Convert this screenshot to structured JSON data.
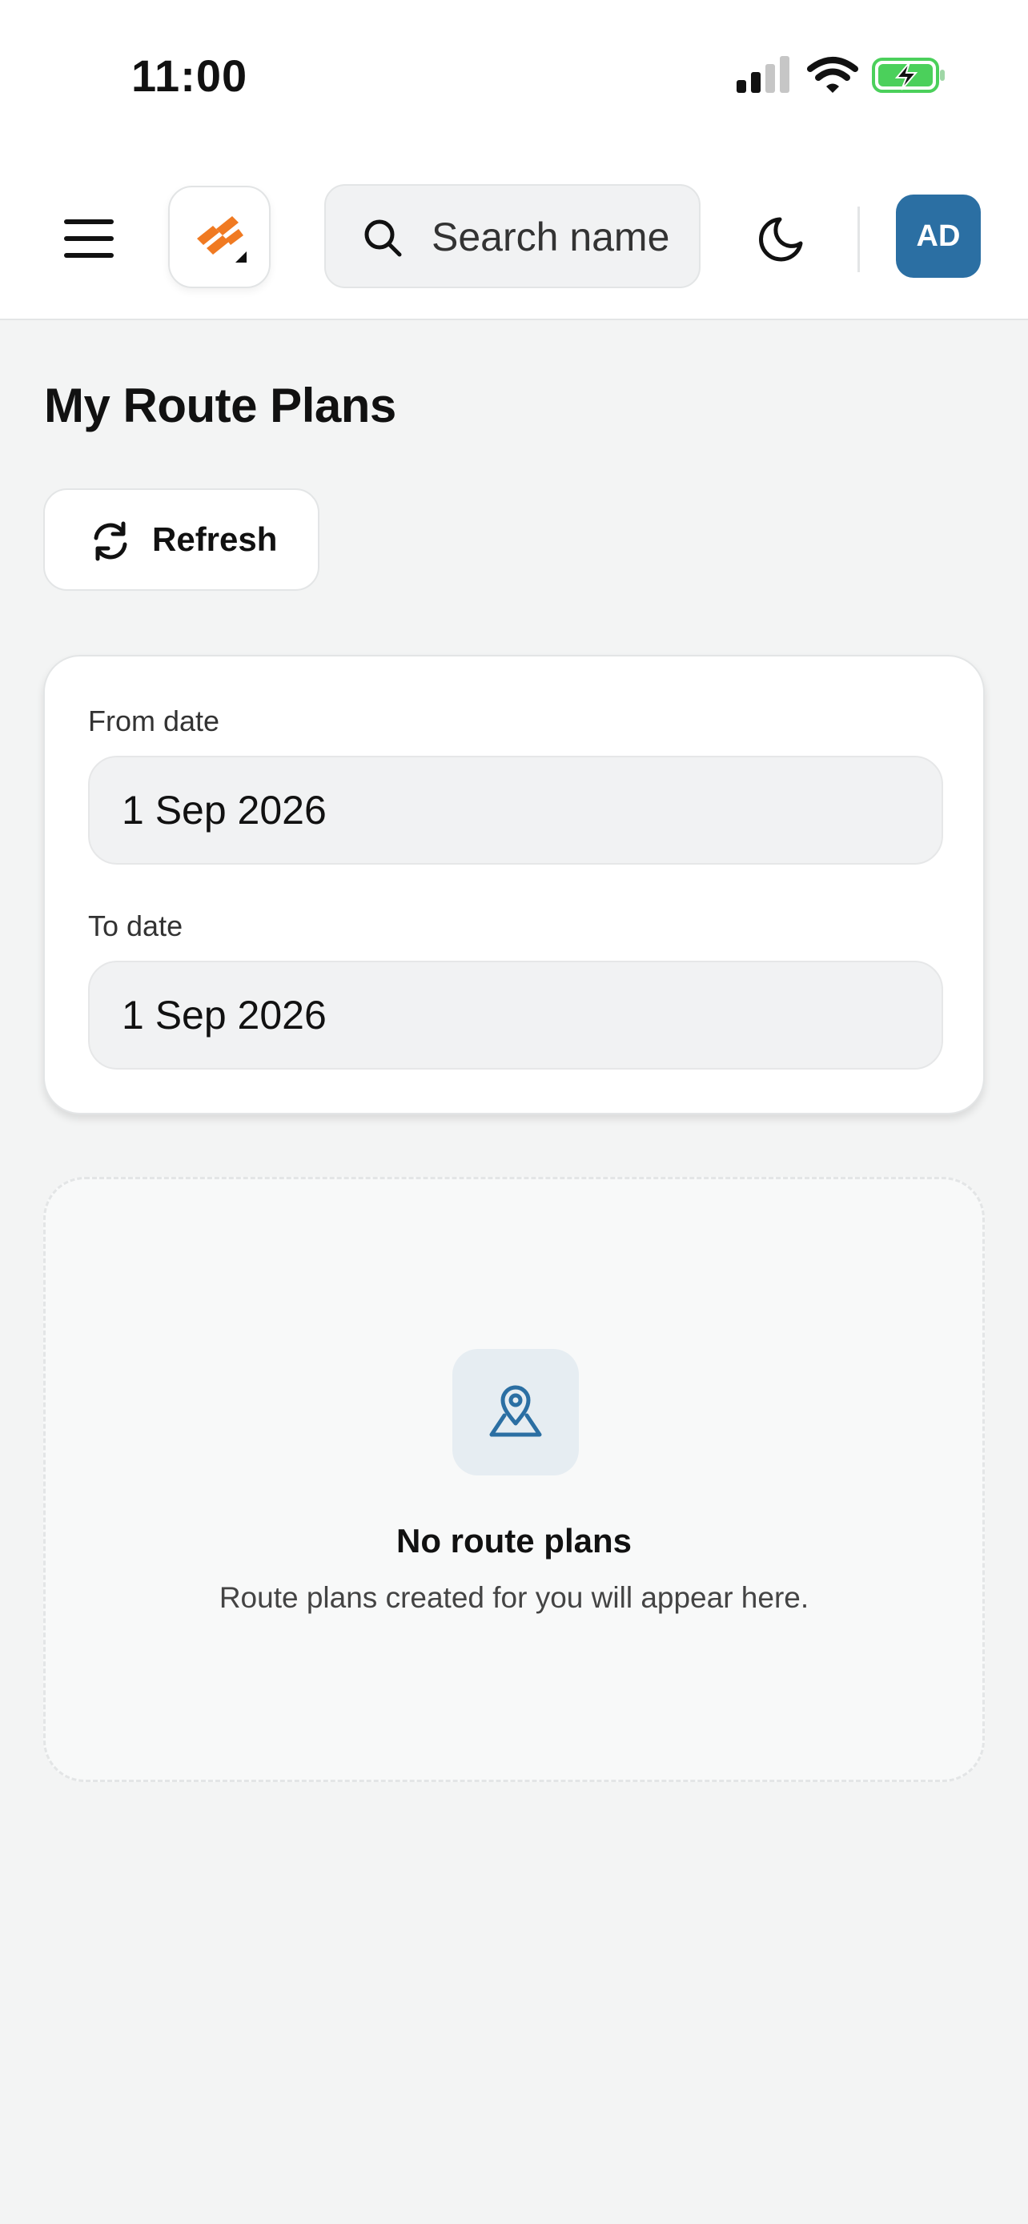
{
  "status_bar": {
    "time": "11:00",
    "icons": [
      "cellular-signal-icon",
      "wifi-icon",
      "battery-charging-icon"
    ],
    "battery_color": "#4bd05b"
  },
  "header": {
    "menu_icon": "hamburger-menu-icon",
    "logo_icon": "brand-logo-icon",
    "brand_color": "#f07a22",
    "search": {
      "placeholder": "Search name",
      "value": ""
    },
    "theme_icon": "moon-icon",
    "avatar_initials": "AD",
    "avatar_color": "#2b6fa3"
  },
  "main": {
    "title": "My Route Plans",
    "refresh_label": "Refresh",
    "filters": {
      "from_label": "From date",
      "from_value": "1 Sep 2026",
      "to_label": "To date",
      "to_value": "1 Sep 2026"
    },
    "empty_state": {
      "icon": "map-pin-icon",
      "title": "No route plans",
      "subtitle": "Route plans created for you will appear here."
    }
  }
}
